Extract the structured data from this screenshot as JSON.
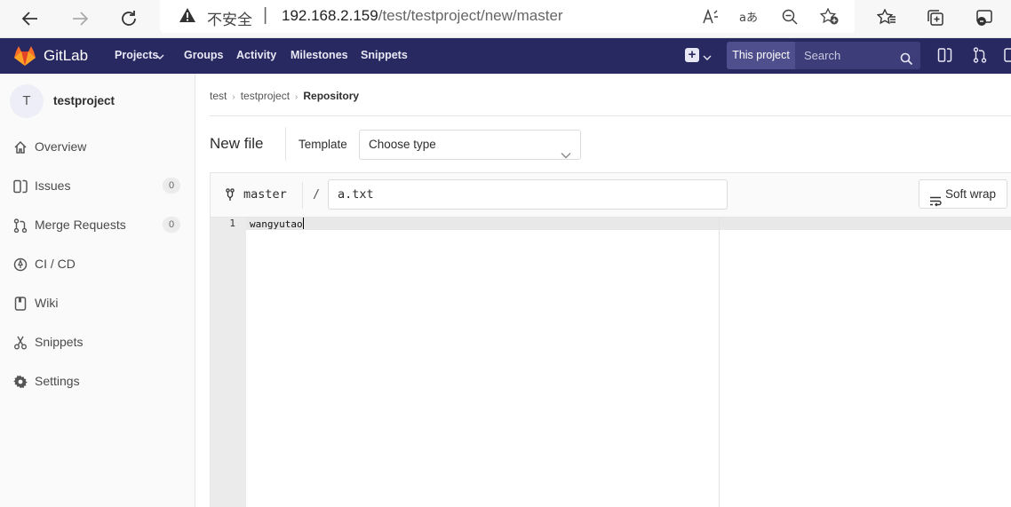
{
  "browser": {
    "insecure_label": "不安全",
    "url_host": "192.168.2.159",
    "url_path": "/test/testproject/new/master"
  },
  "header": {
    "brand": "GitLab",
    "nav": [
      "Projects",
      "Groups",
      "Activity",
      "Milestones",
      "Snippets"
    ],
    "search_scope": "This project",
    "search_placeholder": "Search"
  },
  "sidebar": {
    "avatar_letter": "T",
    "project_name": "testproject",
    "items": [
      {
        "label": "Overview",
        "icon": "home-icon"
      },
      {
        "label": "Issues",
        "icon": "issues-icon",
        "count": "0"
      },
      {
        "label": "Merge Requests",
        "icon": "merge-request-icon",
        "count": "0"
      },
      {
        "label": "CI / CD",
        "icon": "rocket-icon"
      },
      {
        "label": "Wiki",
        "icon": "book-icon"
      },
      {
        "label": "Snippets",
        "icon": "scissors-icon"
      },
      {
        "label": "Settings",
        "icon": "gear-icon"
      }
    ]
  },
  "breadcrumb": [
    "test",
    "testproject",
    "Repository"
  ],
  "page": {
    "title": "New file",
    "template_label": "Template",
    "template_value": "Choose type"
  },
  "editor": {
    "branch": "master",
    "path_sep": "/",
    "file_name": "a.txt",
    "soft_wrap_label": "Soft wrap",
    "lines": [
      {
        "number": "1",
        "text": "wangyutao"
      }
    ]
  },
  "colors": {
    "header_bg": "#292961",
    "gitlab_orange": "#e24329",
    "sidebar_bg": "#fafafa"
  }
}
